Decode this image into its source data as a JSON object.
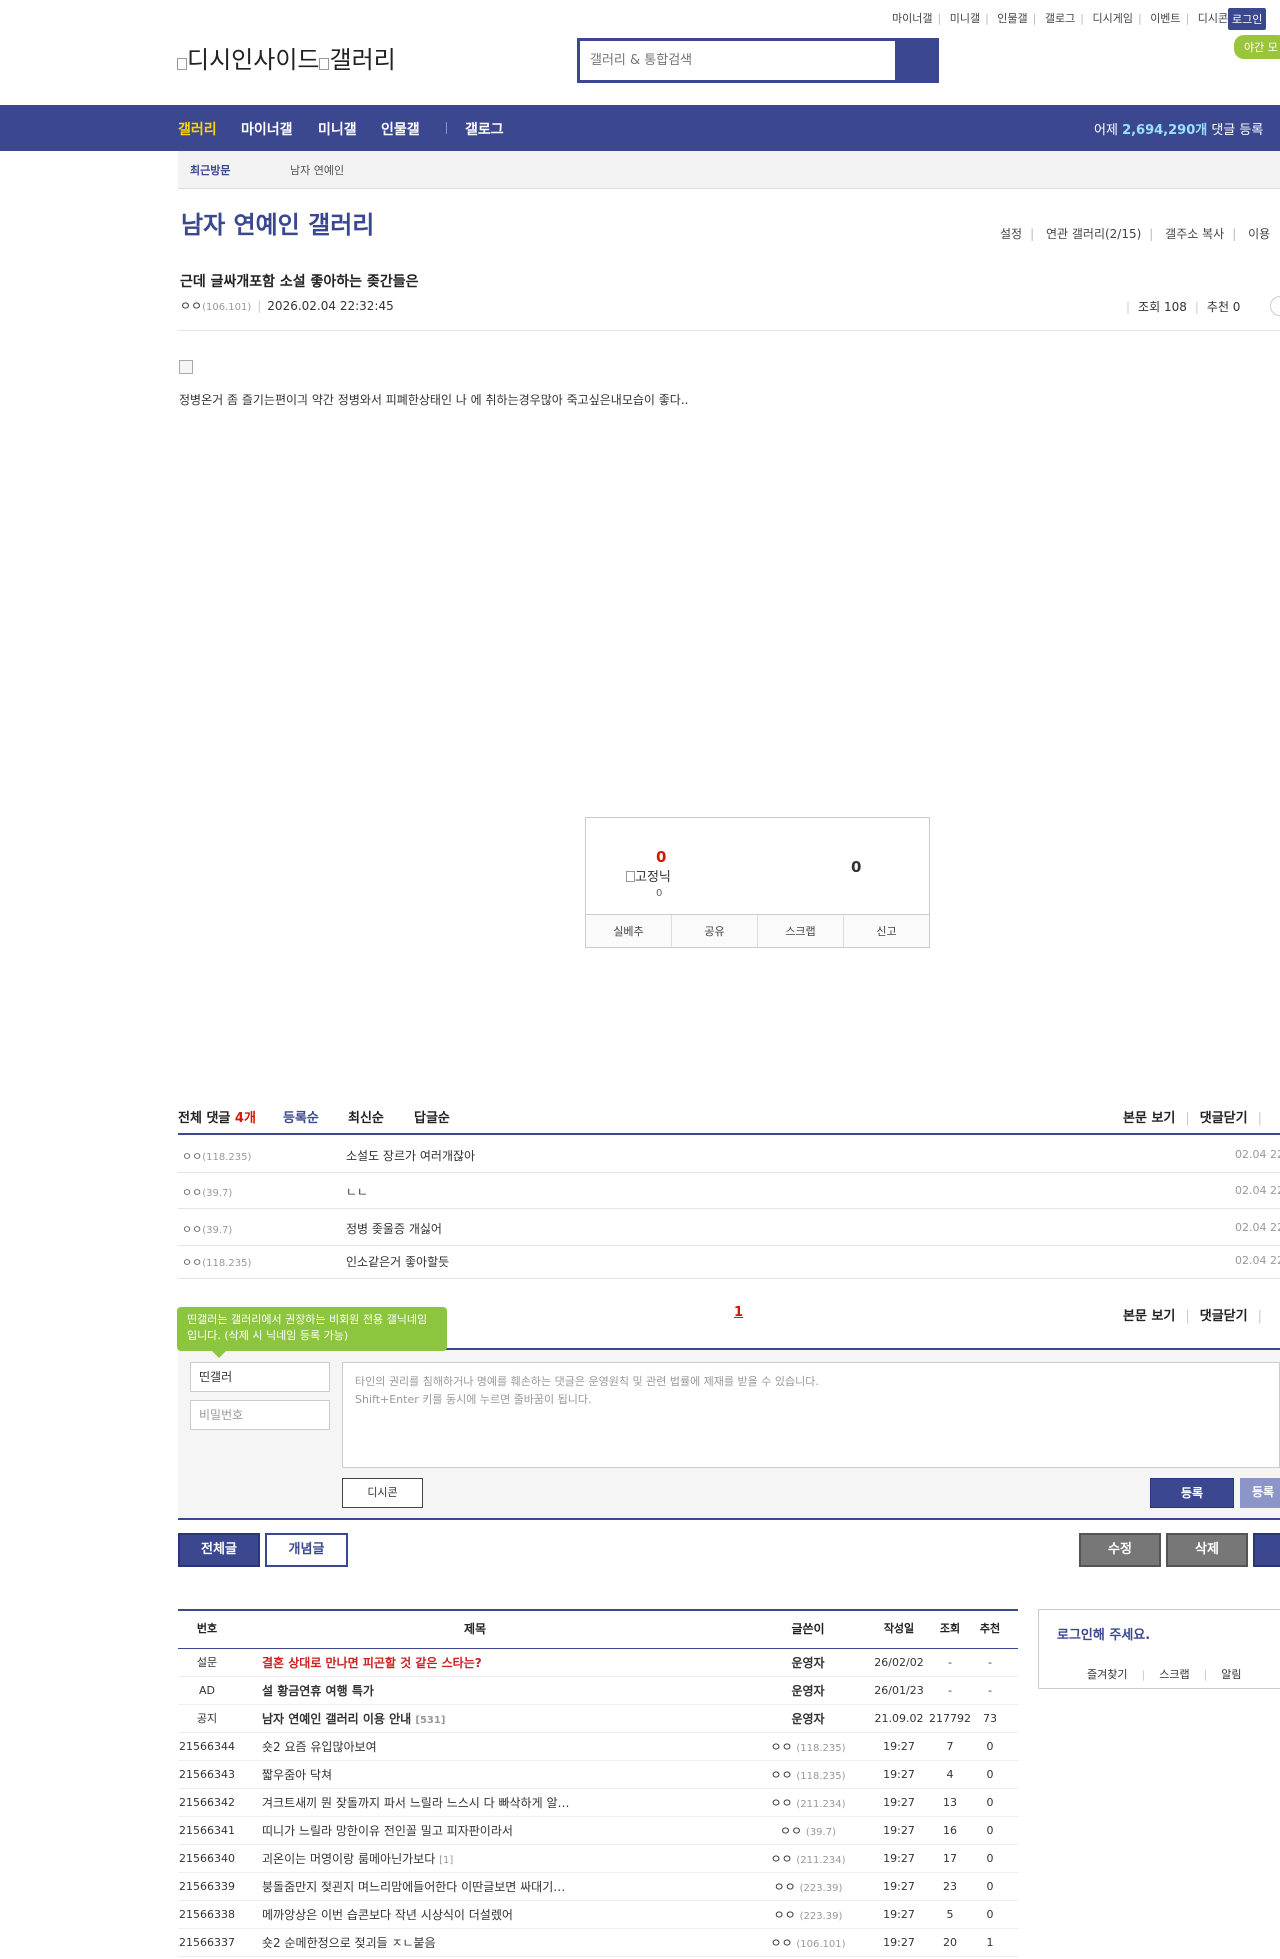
{
  "top_menu": [
    "마이너갤",
    "미니갤",
    "인물갤",
    "갤로그",
    "디시게임",
    "이벤트",
    "디시콘"
  ],
  "login_label": "로그인",
  "night_mode_label": "야간 모",
  "logo_alt": "디시인사이드",
  "logo_gallery_alt": "갤러리",
  "search_placeholder": "갤러리 & 통합검색",
  "nav": {
    "items": [
      "갤러리",
      "마이너갤",
      "미니갤",
      "인물갤",
      "갤로그"
    ],
    "yesterday_prefix": "어제 ",
    "yesterday_count": "2,694,290개",
    "yesterday_suffix": " 댓글 등록"
  },
  "recent_visit": {
    "label": "최근방문",
    "gallery": "남자 연예인"
  },
  "gallery": {
    "title": "남자 연예인 갤러리",
    "menu": [
      "설정",
      "연관 갤러리(2/15)",
      "갤주소 복사",
      "이용"
    ]
  },
  "post": {
    "title": "근데 글싸개포함 소설 좋아하는 좆간들은",
    "author": "ㅇㅇ",
    "ip": "(106.101)",
    "datetime": "2026.02.04 22:32:45",
    "views_label": "조회 108",
    "recommend_label": "추천 0",
    "body": "정병온거 좀 즐기는편이긔 약간 정병와서 피폐한상태인 나 에 취하는경우많아 죽고싶은내모습이 좋다.."
  },
  "recommend": {
    "up": "0",
    "fixed_nick_alt": "고정닉",
    "fixed_count": "0",
    "down": "0",
    "buttons": [
      "실베추",
      "공유",
      "스크랩",
      "신고"
    ]
  },
  "comments": {
    "total_label": "전체 댓글 ",
    "count": "4개",
    "sorts": [
      "등록순",
      "최신순",
      "답글순"
    ],
    "right_links": [
      "본문 보기",
      "댓글닫기"
    ],
    "items": [
      {
        "nick": "ㅇㅇ",
        "ip": "(118.235)",
        "text": "소설도 장르가 여러개잖아",
        "date": "02.04 22"
      },
      {
        "nick": "ㅇㅇ",
        "ip": "(39.7)",
        "text": "ㄴㄴ",
        "date": "02.04 22"
      },
      {
        "nick": "ㅇㅇ",
        "ip": "(39.7)",
        "text": "정병 좆울증 개싫어",
        "date": "02.04 22"
      },
      {
        "nick": "ㅇㅇ",
        "ip": "(118.235)",
        "text": "인소같은거 좋아할듯",
        "date": "02.04 22"
      }
    ],
    "page": "1"
  },
  "write": {
    "tooltip": "띤갤러는 갤러리에서 권장하는 비회원 전용 갤닉네임입니다. (삭제 시 닉네임 등록 가능)",
    "nick_value": "띤갤러",
    "password_placeholder": "비밀번호",
    "notice_line1": "타인의 권리를 침해하거나 명예를 훼손하는 댓글은 운영원칙 및 관련 법률에 제재를 받을 수 있습니다.",
    "notice_line2": "Shift+Enter 키를 동시에 누르면 줄바꿈이 됩니다.",
    "dccon_label": "디시콘",
    "submit_label": "등록",
    "submit2_label": "등록"
  },
  "list_buttons": {
    "all": "전체글",
    "concept": "개념글",
    "edit": "수정",
    "delete": "삭제"
  },
  "list": {
    "headers": [
      "번호",
      "제목",
      "글쓴이",
      "작성일",
      "조회",
      "추천"
    ],
    "rows": [
      {
        "num": "설문",
        "subject": "결혼 상대로 만나면 피곤할 것 같은 스타는?",
        "style": "survey",
        "writer": "운영자",
        "ip": "",
        "date": "26/02/02",
        "views": "-",
        "rec": "-",
        "reply": ""
      },
      {
        "num": "AD",
        "subject": "설 황금연휴 여행 특가",
        "style": "bold",
        "writer": "운영자",
        "ip": "",
        "date": "26/01/23",
        "views": "-",
        "rec": "-",
        "reply": ""
      },
      {
        "num": "공지",
        "subject": "남자 연예인 갤러리 이용 안내",
        "style": "bold",
        "writer": "운영자",
        "ip": "",
        "date": "21.09.02",
        "views": "217792",
        "rec": "73",
        "reply": "[531]"
      },
      {
        "num": "21566344",
        "subject": "숏2 요즘 유입많아보여",
        "style": "",
        "writer": "ㅇㅇ",
        "ip": "(118.235)",
        "date": "19:27",
        "views": "7",
        "rec": "0",
        "reply": ""
      },
      {
        "num": "21566343",
        "subject": "짧우줌아 닥쳐",
        "style": "",
        "writer": "ㅇㅇ",
        "ip": "(118.235)",
        "date": "19:27",
        "views": "4",
        "rec": "0",
        "reply": ""
      },
      {
        "num": "21566342",
        "subject": "겨크트새끼 뭔 잦돌까지 파서 느릴라 느스시 다 빠삭하게 알…",
        "style": "",
        "writer": "ㅇㅇ",
        "ip": "(211.234)",
        "date": "19:27",
        "views": "13",
        "rec": "0",
        "reply": ""
      },
      {
        "num": "21566341",
        "subject": "띠니가 느릴라 망한이유 전인꼴 밀고 피자판이라서",
        "style": "",
        "writer": "ㅇㅇ",
        "ip": "(39.7)",
        "date": "19:27",
        "views": "16",
        "rec": "0",
        "reply": ""
      },
      {
        "num": "21566340",
        "subject": "괴온이는 머영이랑 룸메아닌가보다",
        "style": "",
        "writer": "ㅇㅇ",
        "ip": "(211.234)",
        "date": "19:27",
        "views": "17",
        "rec": "0",
        "reply": "[1]"
      },
      {
        "num": "21566339",
        "subject": "붕돌줌만지 젖괸지 며느리맘에들어한다 이딴글보면 싸대기…",
        "style": "",
        "writer": "ㅇㅇ",
        "ip": "(223.39)",
        "date": "19:27",
        "views": "23",
        "rec": "0",
        "reply": ""
      },
      {
        "num": "21566338",
        "subject": "메까앙상은 이번 습콘보다 작년 시상식이 더설렜어",
        "style": "",
        "writer": "ㅇㅇ",
        "ip": "(223.39)",
        "date": "19:27",
        "views": "5",
        "rec": "0",
        "reply": ""
      },
      {
        "num": "21566337",
        "subject": "숏2 순메한정으로 젖괴들 ㅈㄴ붙음",
        "style": "",
        "writer": "ㅇㅇ",
        "ip": "(106.101)",
        "date": "19:27",
        "views": "20",
        "rec": "1",
        "reply": ""
      }
    ]
  },
  "login_box": {
    "title": "로그인해 주세요.",
    "links": [
      "즐겨찾기",
      "스크랩",
      "알림"
    ]
  }
}
